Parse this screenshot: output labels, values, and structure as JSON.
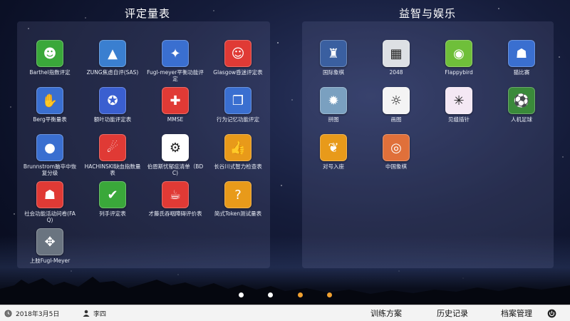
{
  "left_panel": {
    "title": "评定量表",
    "apps": [
      {
        "label": "Barthel指数评定",
        "color": "#3aa83a",
        "icon": "head-lock-icon"
      },
      {
        "label": "ZUNG焦虑自评(SAS)",
        "color": "#3a7fd0",
        "icon": "landscape-icon"
      },
      {
        "label": "Fugl-meyer平衡功能评定",
        "color": "#3a6fd0",
        "icon": "lightbulb-icon"
      },
      {
        "label": "Glasgow昏迷评定表",
        "color": "#e03a35",
        "icon": "people-icon"
      },
      {
        "label": "Berg平衡量表",
        "color": "#3a6fd0",
        "icon": "hand-icon"
      },
      {
        "label": "额叶功能评定表",
        "color": "#3a5fd0",
        "icon": "medal-icon"
      },
      {
        "label": "MMSE",
        "color": "#e03a35",
        "icon": "brain-icon"
      },
      {
        "label": "行为记忆功能评定",
        "color": "#3a6fd0",
        "icon": "book-head-icon"
      },
      {
        "label": "Brunnstrom脑卒中恢复分级",
        "color": "#3a6fd0",
        "icon": "head-icon"
      },
      {
        "label": "HACHINSKI缺血指数量表",
        "color": "#e03a35",
        "icon": "comet-icon"
      },
      {
        "label": "伯恩斯忧郁症清单（BDC)",
        "color": "#ffffff",
        "icon": "gear-head-icon"
      },
      {
        "label": "长谷川式智力检查表",
        "color": "#e89a1a",
        "icon": "thumbs-head-icon"
      },
      {
        "label": "社会功能活动问卷(FAQ)",
        "color": "#e03a35",
        "icon": "group-icon"
      },
      {
        "label": "列手评定表",
        "color": "#3aa83a",
        "icon": "shoe-icon"
      },
      {
        "label": "才藤氏吞咽障碍评价表",
        "color": "#e03a35",
        "icon": "cup-icon"
      },
      {
        "label": "简式Token测试量表",
        "color": "#e89a1a",
        "icon": "question-head-icon"
      },
      {
        "label": "上肢Fugl-Meyer",
        "color": "#6a7480",
        "icon": "handshake-icon"
      }
    ]
  },
  "right_panel": {
    "title": "益智与娱乐",
    "apps": [
      {
        "label": "国际象棋",
        "color": "#3a5fa0",
        "icon": "chess-icon"
      },
      {
        "label": "2048",
        "color": "#dde0e4",
        "icon": "grid-2048-icon"
      },
      {
        "label": "Flappybird",
        "color": "#6fbf3a",
        "icon": "bird-icon"
      },
      {
        "label": "猫比赛",
        "color": "#3a6fd0",
        "icon": "cat-icon"
      },
      {
        "label": "拼图",
        "color": "#7aa0c0",
        "icon": "hedgehog-icon"
      },
      {
        "label": "画图",
        "color": "#f4f4f4",
        "icon": "lion-drawing-icon"
      },
      {
        "label": "见缝插针",
        "color": "#f4e8f4",
        "icon": "needle-wheel-icon"
      },
      {
        "label": "人机足球",
        "color": "#3a8a3a",
        "icon": "football-icon"
      },
      {
        "label": "对号入座",
        "color": "#e89a1a",
        "icon": "bow-icon"
      },
      {
        "label": "中国象棋",
        "color": "#e0703a",
        "icon": "xiangqi-icon"
      }
    ]
  },
  "page_dots": [
    {
      "color": "#ffffff"
    },
    {
      "color": "#ffffff"
    },
    {
      "color": "#f0a030"
    },
    {
      "color": "#f0a030"
    }
  ],
  "bottom_bar": {
    "date": "2018年3月5日",
    "user": "李四",
    "nav": [
      "训练方案",
      "历史记录",
      "档案管理"
    ]
  }
}
